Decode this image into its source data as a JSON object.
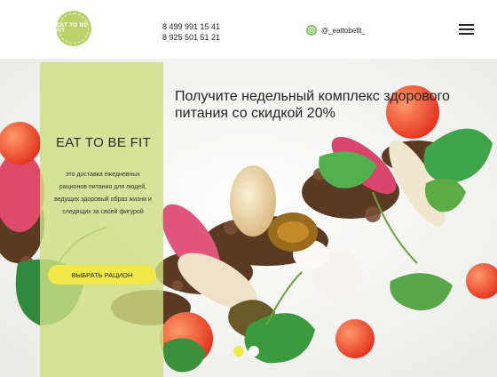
{
  "header": {
    "logo_text": "EAT TO BE FIT",
    "phones": [
      "8 499 991 15 41",
      "8 925 501 51 21"
    ],
    "instagram_handle": "@_eattobefit_",
    "menu_icon": "hamburger-icon"
  },
  "hero": {
    "brand": "EAT TO BE FIT",
    "tagline": "это доставка ежедневных рационов питания для людей, ведущих здоровый образ жизни и следящих за своей фигурой",
    "cta_label": "ВЫБРАТЬ РАЦИОН",
    "headline": "Получите недельный комплекс здорового питания со скидкой 20%"
  },
  "slider": {
    "active_index": 0,
    "count": 2
  },
  "colors": {
    "accent_green": "#b9d36a",
    "panel_green": "#cede82",
    "button_yellow": "#f3e84a",
    "dot_active": "#f3e84a",
    "dot_inactive": "#ffffff"
  }
}
